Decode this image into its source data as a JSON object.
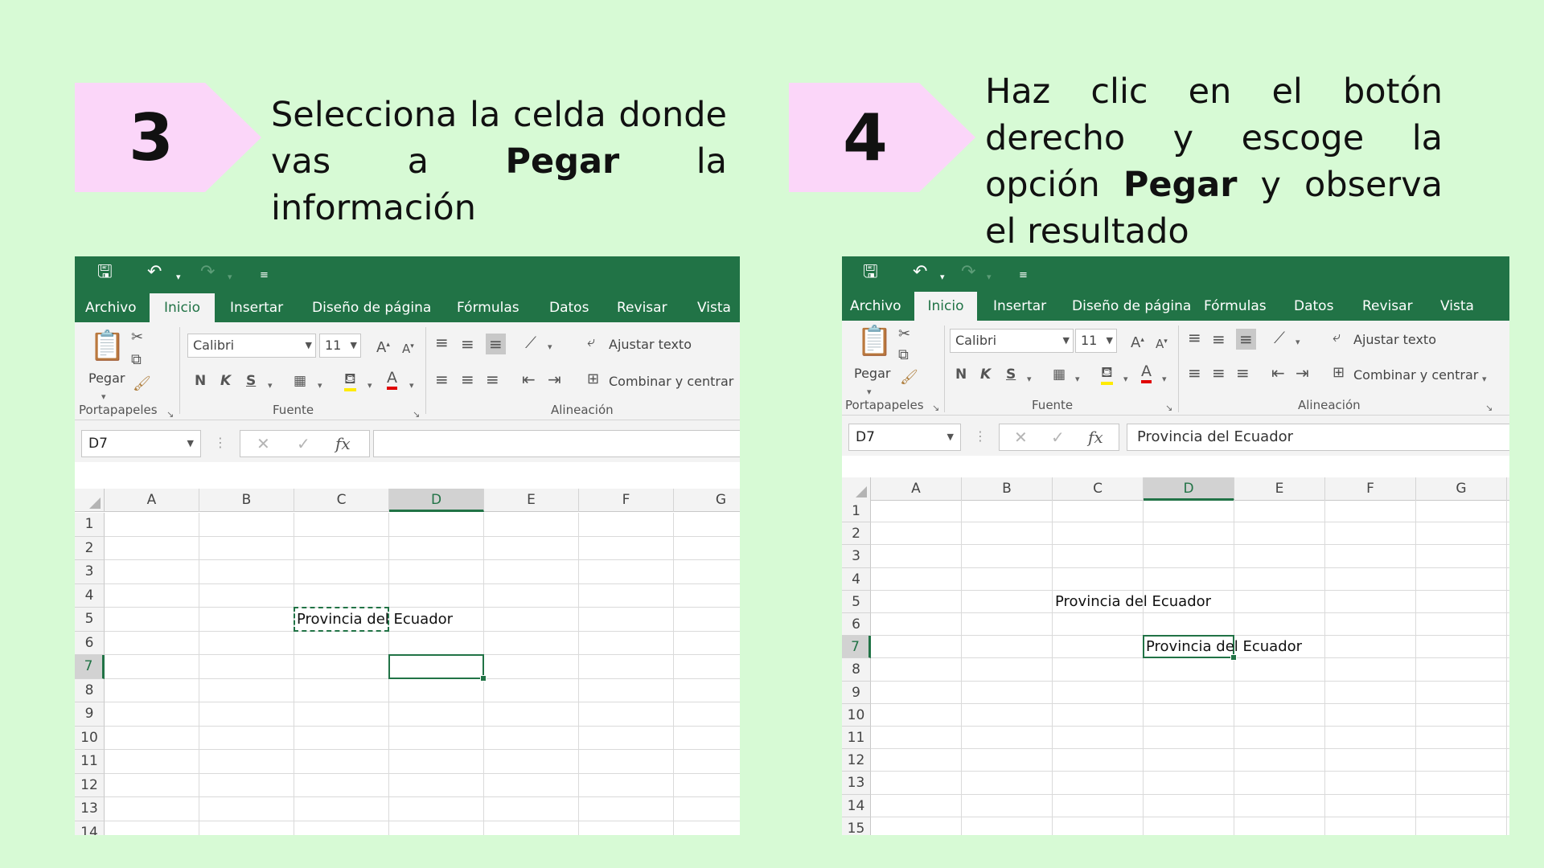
{
  "steps": [
    {
      "number": "3",
      "text_before": "Selecciona la celda donde vas a ",
      "bold": "Pegar",
      "text_after": " la información"
    },
    {
      "number": "4",
      "text_before": "Haz clic en el botón derecho y escoge la opción ",
      "bold": "Pegar",
      "text_after": " y observa el resultado"
    }
  ],
  "colors": {
    "background": "#d7fad5",
    "badge": "#fbd6f9",
    "excel_green": "#217346"
  },
  "excel_left": {
    "tabs": [
      "Archivo",
      "Inicio",
      "Insertar",
      "Diseño de página",
      "Fórmulas",
      "Datos",
      "Revisar",
      "Vista"
    ],
    "active_tab": "Inicio",
    "ribbon": {
      "paste_label": "Pegar",
      "font_name": "Calibri",
      "font_size": "11",
      "bold": "N",
      "italic": "K",
      "underline": "S",
      "wrap_text": "Ajustar texto",
      "merge_center": "Combinar y centrar",
      "group_clipboard": "Portapapeles",
      "group_font": "Fuente",
      "group_alignment": "Alineación"
    },
    "name_box": "D7",
    "formula": "",
    "columns": [
      "A",
      "B",
      "C",
      "D",
      "E",
      "F",
      "G"
    ],
    "rows": [
      "1",
      "2",
      "3",
      "4",
      "5",
      "6",
      "7",
      "8",
      "9",
      "10",
      "11",
      "12",
      "13",
      "14"
    ],
    "selected_column": "D",
    "selected_row": "7",
    "cells": [
      {
        "ref": "C5",
        "value": "Provincia del Ecuador",
        "state": "copy-marquee"
      }
    ],
    "active_cell": "D7"
  },
  "excel_right": {
    "tabs": [
      "Archivo",
      "Inicio",
      "Insertar",
      "Diseño de página",
      "Fórmulas",
      "Datos",
      "Revisar",
      "Vista"
    ],
    "active_tab": "Inicio",
    "ribbon": {
      "paste_label": "Pegar",
      "font_name": "Calibri",
      "font_size": "11",
      "bold": "N",
      "italic": "K",
      "underline": "S",
      "wrap_text": "Ajustar texto",
      "merge_center": "Combinar y centrar",
      "group_clipboard": "Portapapeles",
      "group_font": "Fuente",
      "group_alignment": "Alineación"
    },
    "name_box": "D7",
    "formula": "Provincia del Ecuador",
    "columns": [
      "A",
      "B",
      "C",
      "D",
      "E",
      "F",
      "G"
    ],
    "rows": [
      "1",
      "2",
      "3",
      "4",
      "5",
      "6",
      "7",
      "8",
      "9",
      "10",
      "11",
      "12",
      "13",
      "14",
      "15"
    ],
    "selected_column": "D",
    "selected_row": "7",
    "cells": [
      {
        "ref": "C5",
        "value": "Provincia del Ecuador",
        "state": "normal"
      },
      {
        "ref": "D7",
        "value": "Provincia del Ecuador",
        "state": "active"
      }
    ],
    "active_cell": "D7"
  }
}
